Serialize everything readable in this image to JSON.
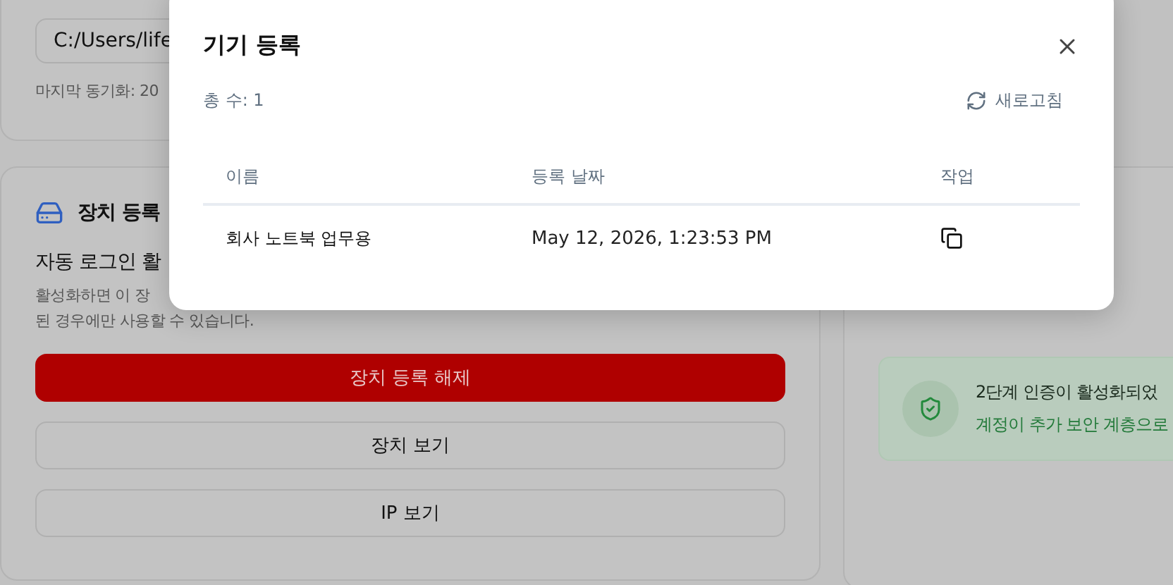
{
  "sync_card": {
    "path_value": "C:/Users/life",
    "last_sync": "마지막 동기화: 20"
  },
  "device_card": {
    "title": "장치 등록",
    "subtitle": "자동 로그인 활",
    "description_lines": [
      "활성화하면 이 장",
      "된 경우에만 사용할 수 있습니다."
    ],
    "buttons": [
      {
        "label": "장치 등록 해제",
        "kind": "danger"
      },
      {
        "label": "장치 보기",
        "kind": "outline"
      },
      {
        "label": "IP 보기",
        "kind": "outline"
      }
    ]
  },
  "security_card": {
    "status_title": "2단계 인증이 활성화되었",
    "status_text": "계정이 추가 보안 계층으로"
  },
  "modal": {
    "title": "기기 등록",
    "total": "총 수: 1",
    "refresh": "새로고침",
    "columns": [
      "이름",
      "등록 날짜",
      "작업"
    ],
    "rows": [
      {
        "name": "회사 노트북 업무용",
        "date": "May 12, 2026, 1:23:53 PM"
      }
    ]
  }
}
